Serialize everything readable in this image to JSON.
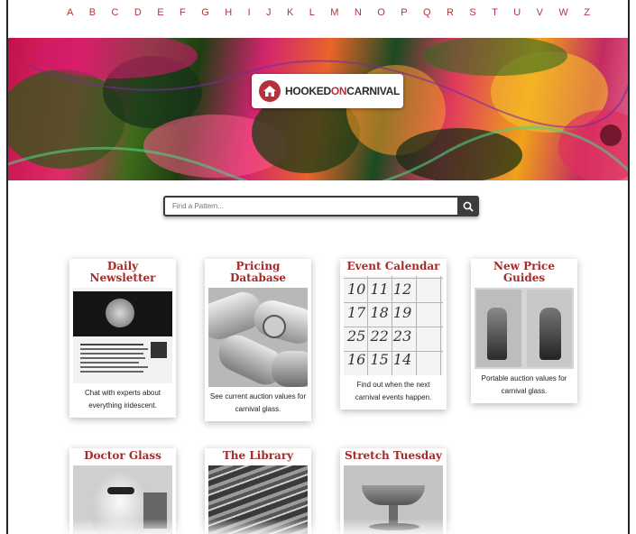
{
  "alphabet": [
    "A",
    "B",
    "C",
    "D",
    "E",
    "F",
    "G",
    "H",
    "I",
    "J",
    "K",
    "L",
    "M",
    "N",
    "O",
    "P",
    "Q",
    "R",
    "S",
    "T",
    "U",
    "V",
    "W",
    "Z"
  ],
  "logo": {
    "part1": "HOOKED",
    "part2": "ON",
    "part3": "CARNIVAL"
  },
  "search": {
    "placeholder": "Find a Pattern..."
  },
  "cards": [
    {
      "title": "Daily Newsletter",
      "description": "Chat with experts about everything iridescent."
    },
    {
      "title": "Pricing Database",
      "description": "See current auction values for carnival glass."
    },
    {
      "title": "Event Calendar",
      "description": "Find out when the next carnival events happen."
    },
    {
      "title": "New Price Guides",
      "description": "Portable auction values for carnival glass."
    },
    {
      "title": "Doctor Glass",
      "description": ""
    },
    {
      "title": "The Library",
      "description": ""
    },
    {
      "title": "Stretch Tuesday",
      "description": ""
    }
  ],
  "calendar_numbers": [
    "10",
    "11",
    "12",
    "17",
    "18",
    "19",
    "25",
    "22",
    "23",
    "16",
    "15",
    "14"
  ],
  "colors": {
    "accent": "#b5323c",
    "title": "#a52a2a",
    "search_button": "#3c3c3c"
  }
}
